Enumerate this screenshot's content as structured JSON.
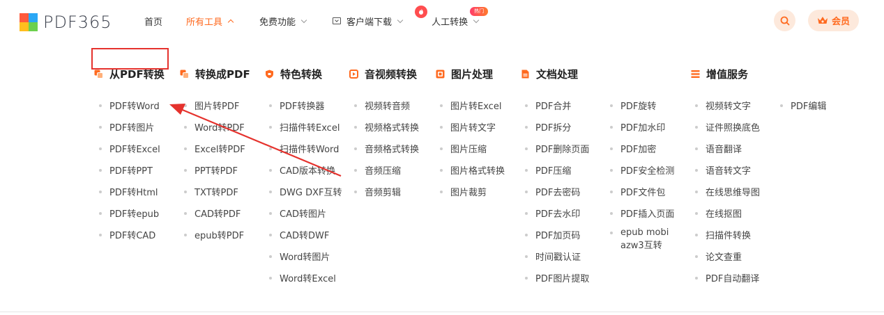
{
  "logo": {
    "text": "PDF365"
  },
  "nav": {
    "home": "首页",
    "all_tools": "所有工具",
    "free": "免费功能",
    "client": "客户端下载",
    "manual": "人工转换",
    "hot_badge": "热门"
  },
  "header": {
    "vip": "会员"
  },
  "categories": [
    {
      "title": "从PDF转换",
      "items": [
        "PDF转Word",
        "PDF转图片",
        "PDF转Excel",
        "PDF转PPT",
        "PDF转Html",
        "PDF转epub",
        "PDF转CAD"
      ]
    },
    {
      "title": "转换成PDF",
      "items": [
        "图片转PDF",
        "Word转PDF",
        "Excel转PDF",
        "PPT转PDF",
        "TXT转PDF",
        "CAD转PDF",
        "epub转PDF"
      ]
    },
    {
      "title": "特色转换",
      "items": [
        "PDF转换器",
        "扫描件转Excel",
        "扫描件转Word",
        "CAD版本转换",
        "DWG DXF互转",
        "CAD转图片",
        "CAD转DWF",
        "Word转图片",
        "Word转Excel"
      ]
    },
    {
      "title": "音视频转换",
      "items": [
        "视频转音频",
        "视频格式转换",
        "音频格式转换",
        "音频压缩",
        "音频剪辑"
      ]
    },
    {
      "title": "图片处理",
      "items": [
        "图片转Excel",
        "图片转文字",
        "图片压缩",
        "图片格式转换",
        "图片裁剪"
      ]
    },
    {
      "title": "文档处理",
      "items": [
        "PDF合并",
        "PDF拆分",
        "PDF删除页面",
        "PDF压缩",
        "PDF去密码",
        "PDF去水印",
        "PDF加页码",
        "时间戳认证",
        "PDF图片提取"
      ]
    },
    {
      "title": "",
      "items": [
        "PDF旋转",
        "PDF加水印",
        "PDF加密",
        "PDF安全检测",
        "PDF文件包",
        "PDF插入页面",
        "epub mobi azw3互转"
      ]
    },
    {
      "title": "增值服务",
      "items": [
        "视频转文字",
        "证件照换底色",
        "语音翻译",
        "语音转文字",
        "在线思维导图",
        "在线抠图",
        "扫描件转换",
        "论文查重",
        "PDF自动翻译"
      ]
    },
    {
      "title": "",
      "items": [
        "PDF编辑"
      ]
    }
  ],
  "colors": {
    "accent": "#ff6a1f",
    "highlight": "#e5322d"
  }
}
